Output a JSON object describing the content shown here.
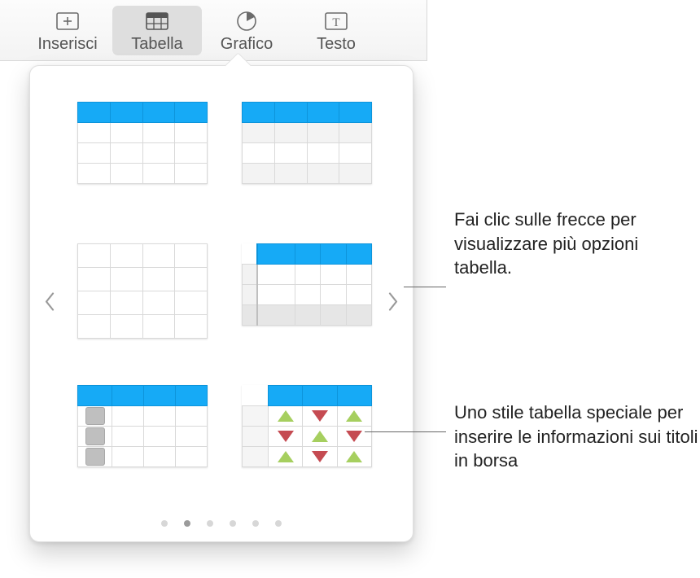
{
  "toolbar": {
    "items": [
      {
        "label": "Inserisci",
        "icon": "insert-icon"
      },
      {
        "label": "Tabella",
        "icon": "table-icon",
        "active": true
      },
      {
        "label": "Grafico",
        "icon": "chart-icon"
      },
      {
        "label": "Testo",
        "icon": "text-icon"
      }
    ]
  },
  "popover": {
    "page_count": 6,
    "active_page_index": 1,
    "styles": [
      {
        "name": "table-style-header-plain"
      },
      {
        "name": "table-style-header-alternating"
      },
      {
        "name": "table-style-no-header"
      },
      {
        "name": "table-style-header-gutter-footer"
      },
      {
        "name": "table-style-header-checkbox-column"
      },
      {
        "name": "table-style-stock-triangles"
      }
    ],
    "colors": {
      "accent": "#16aaf6",
      "triangle_up": "#a6cf5f",
      "triangle_down": "#c54b52"
    }
  },
  "callouts": {
    "arrows": "Fai clic sulle frecce per visualizzare più opzioni tabella.",
    "stock_style": "Uno stile tabella speciale per inserire le informazioni sui titoli in borsa"
  }
}
